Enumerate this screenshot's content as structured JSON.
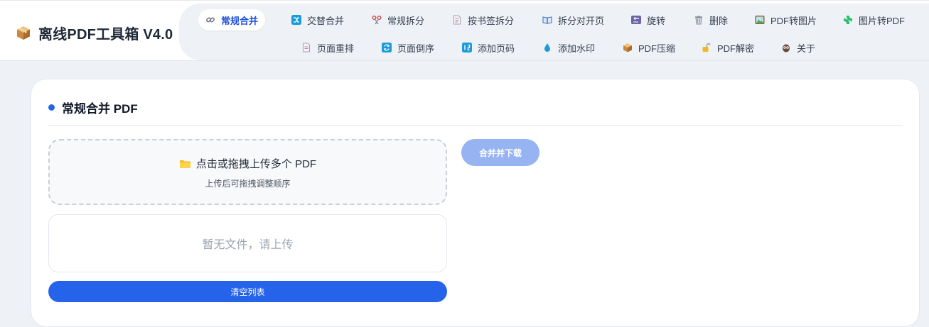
{
  "app": {
    "title": "离线PDF工具箱 V4.0",
    "logo_icon": "package-icon"
  },
  "nav": {
    "row1": [
      {
        "label": "常规合并",
        "icon": "link-icon",
        "active": true
      },
      {
        "label": "交替合并",
        "icon": "shuffle-icon",
        "active": false
      },
      {
        "label": "常规拆分",
        "icon": "scissors-icon",
        "active": false
      },
      {
        "label": "按书签拆分",
        "icon": "bookmark-page-icon",
        "active": false
      },
      {
        "label": "拆分对开页",
        "icon": "open-book-icon",
        "active": false
      },
      {
        "label": "旋转",
        "icon": "rotate-icon",
        "active": false
      },
      {
        "label": "删除",
        "icon": "trash-icon",
        "active": false
      },
      {
        "label": "PDF转图片",
        "icon": "picture-icon",
        "active": false
      },
      {
        "label": "图片转PDF",
        "icon": "puzzle-icon",
        "active": false
      }
    ],
    "row2": [
      {
        "label": "页面重排",
        "icon": "page-icon",
        "active": false
      },
      {
        "label": "页面倒序",
        "icon": "reverse-icon",
        "active": false
      },
      {
        "label": "添加页码",
        "icon": "numbers-icon",
        "active": false
      },
      {
        "label": "添加水印",
        "icon": "droplet-icon",
        "active": false
      },
      {
        "label": "PDF压缩",
        "icon": "package-icon",
        "active": false
      },
      {
        "label": "PDF解密",
        "icon": "unlock-icon",
        "active": false
      },
      {
        "label": "关于",
        "icon": "owl-icon",
        "active": false
      }
    ]
  },
  "panel": {
    "title": "常规合并 PDF",
    "dropzone": {
      "main_text": "点击或拖拽上传多个 PDF",
      "sub_text": "上传后可拖拽调整顺序",
      "icon": "folder-icon"
    },
    "empty_list_text": "暂无文件，请上传",
    "clear_button": "清空列表",
    "merge_button": "合并并下载"
  },
  "colors": {
    "accent": "#2563eb",
    "accent_disabled": "#96b3f2",
    "page_bg": "#eef1f6",
    "active_tab_text": "#1d4ed8"
  }
}
